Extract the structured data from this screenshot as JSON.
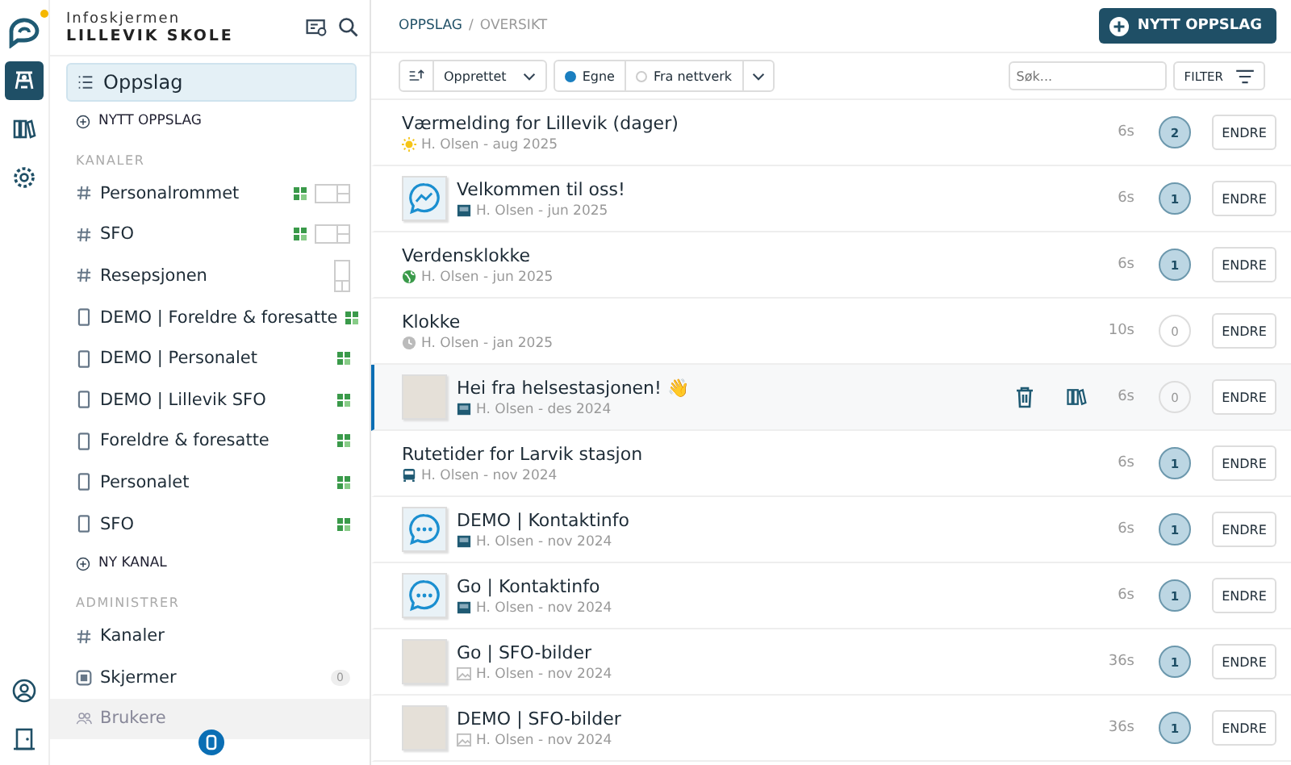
{
  "brand": {
    "line1": "Infoskjermen",
    "line2": "LILLEVIK SKOLE",
    "notification": true
  },
  "rail": [
    {
      "kind": "posts",
      "selected": true
    },
    {
      "kind": "library",
      "selected": false
    },
    {
      "kind": "settings",
      "selected": false
    }
  ],
  "rail_bottom": [
    {
      "kind": "profile"
    },
    {
      "kind": "logout"
    }
  ],
  "nav": {
    "label": "Oppslag",
    "selected": true
  },
  "new_post": "NYTT OPPSLAG",
  "channels_heading": "KANALER",
  "channels": [
    {
      "label": "Personalrommet",
      "kind": "hash",
      "connected": true,
      "preview": {
        "kind": "landscape"
      }
    },
    {
      "label": "SFO",
      "kind": "hash",
      "connected": true,
      "preview": {
        "kind": "landscape"
      }
    },
    {
      "label": "Resepsjonen",
      "kind": "hash",
      "connected": false,
      "preview": {
        "kind": "portrait"
      }
    },
    {
      "label": "DEMO | Foreldre & foresatte",
      "kind": "device",
      "connected": true
    },
    {
      "label": "DEMO | Personalet",
      "kind": "device",
      "connected": true
    },
    {
      "label": "DEMO | Lillevik SFO",
      "kind": "device",
      "connected": true
    },
    {
      "label": "Foreldre & foresatte",
      "kind": "device",
      "connected": true
    },
    {
      "label": "Personalet",
      "kind": "device",
      "connected": true
    },
    {
      "label": "SFO",
      "kind": "device",
      "connected": true
    }
  ],
  "new_channel": "NY KANAL",
  "admin_heading": "ADMINISTRER",
  "admin": [
    {
      "label": "Kanaler",
      "kind": "hash",
      "faded": false
    },
    {
      "label": "Skjermer",
      "kind": "screen",
      "count": "0",
      "faded": false
    },
    {
      "label": "Brukere",
      "kind": "users",
      "faded": true
    }
  ],
  "breadcrumb": {
    "items": [
      "OPPSLAG",
      "OVERSIKT"
    ],
    "separator": "/"
  },
  "new_post_button": "NYTT OPPSLAG",
  "toolbar": {
    "sort": "Opprettet",
    "filters": [
      {
        "label": "Egne",
        "selected": true
      },
      {
        "label": "Fra nettverk",
        "selected": false
      }
    ],
    "search": {
      "placeholder": "Søk..."
    },
    "filter_button": "FILTER"
  },
  "posts": [
    {
      "title": "Værmelding for Lillevik (dager)",
      "meta": "H. Olsen - aug 2025",
      "source": {
        "kind": "sun"
      },
      "duration": "6s",
      "count": "2",
      "active": true,
      "selected": false,
      "action": "ENDRE"
    },
    {
      "title": "Velkommen til oss!",
      "meta": "H. Olsen - jun 2025",
      "source": {
        "kind": "screen"
      },
      "thumbnail": {
        "kind": "chat-graph"
      },
      "duration": "6s",
      "count": "1",
      "active": true,
      "selected": false,
      "action": "ENDRE"
    },
    {
      "title": "Verdensklokke",
      "meta": "H. Olsen - jun 2025",
      "source": {
        "kind": "globe"
      },
      "duration": "6s",
      "count": "1",
      "active": true,
      "selected": false,
      "action": "ENDRE"
    },
    {
      "title": "Klokke",
      "meta": "H. Olsen - jan 2025",
      "source": {
        "kind": "clock"
      },
      "duration": "10s",
      "count": "0",
      "active": false,
      "selected": false,
      "action": "ENDRE"
    },
    {
      "title": "Hei fra helsestasjonen! 👋",
      "meta": "H. Olsen - des 2024",
      "source": {
        "kind": "screen"
      },
      "thumbnail": {
        "kind": "photo"
      },
      "duration": "6s",
      "count": "0",
      "active": false,
      "selected": true,
      "action": "ENDRE"
    },
    {
      "title": "Rutetider for Larvik stasjon",
      "meta": "H. Olsen - nov 2024",
      "source": {
        "kind": "bus"
      },
      "duration": "6s",
      "count": "1",
      "active": true,
      "selected": false,
      "action": "ENDRE"
    },
    {
      "title": "DEMO | Kontaktinfo",
      "meta": "H. Olsen - nov 2024",
      "source": {
        "kind": "screen"
      },
      "thumbnail": {
        "kind": "chat-dots"
      },
      "duration": "6s",
      "count": "1",
      "active": true,
      "selected": false,
      "action": "ENDRE"
    },
    {
      "title": "Go | Kontaktinfo",
      "meta": "H. Olsen - nov 2024",
      "source": {
        "kind": "screen"
      },
      "thumbnail": {
        "kind": "chat-dots"
      },
      "duration": "6s",
      "count": "1",
      "active": true,
      "selected": false,
      "action": "ENDRE"
    },
    {
      "title": "Go | SFO-bilder",
      "meta": "H. Olsen - nov 2024",
      "source": {
        "kind": "image"
      },
      "thumbnail": {
        "kind": "photo"
      },
      "duration": "36s",
      "count": "1",
      "active": true,
      "selected": false,
      "action": "ENDRE"
    },
    {
      "title": "DEMO | SFO-bilder",
      "meta": "H. Olsen - nov 2024",
      "source": {
        "kind": "image"
      },
      "thumbnail": {
        "kind": "photo"
      },
      "duration": "36s",
      "count": "1",
      "active": true,
      "selected": false,
      "action": "ENDRE"
    }
  ]
}
